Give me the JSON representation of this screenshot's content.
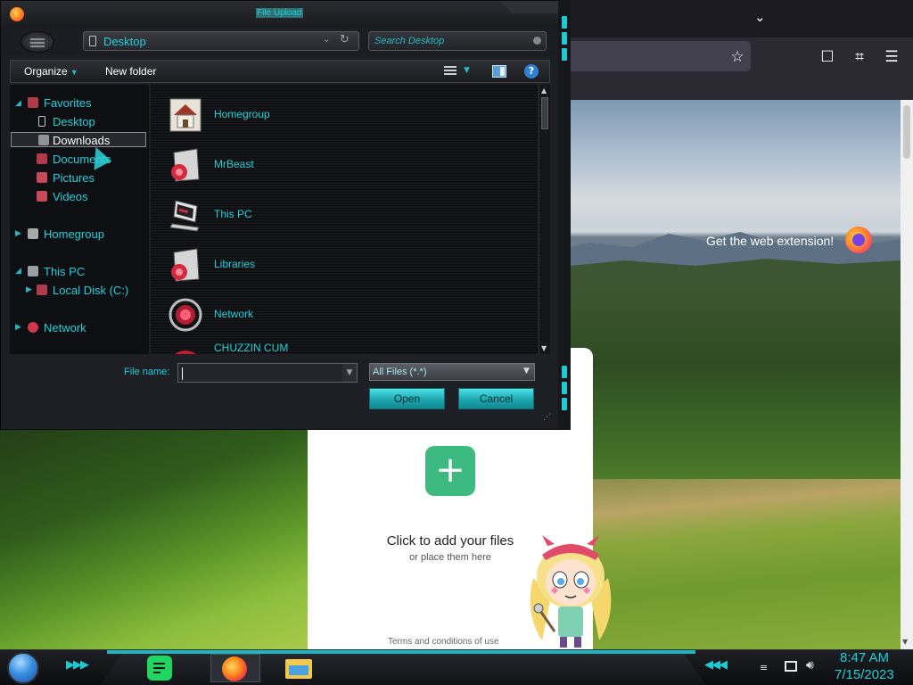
{
  "browser": {
    "banner_text": "Get the web extension!",
    "icons": [
      "chevron-down-icon",
      "bookmark-star-icon",
      "pocket-icon",
      "extensions-icon",
      "menu-icon"
    ]
  },
  "upload": {
    "title": "Click to add your files",
    "subtitle": "or place them here",
    "add_symbol": "+",
    "terms": "Terms and conditions of use"
  },
  "dialog": {
    "title": "File Upload",
    "address": "Desktop",
    "search_placeholder": "Search Desktop",
    "toolbar": {
      "organize_label": "Organize",
      "new_folder_label": "New folder",
      "help_label": "?"
    },
    "nav": {
      "favorites": "Favorites",
      "desktop": "Desktop",
      "downloads": "Downloads",
      "documents": "Documents",
      "pictures": "Pictures",
      "videos": "Videos",
      "homegroup": "Homegroup",
      "this_pc": "This PC",
      "local_disk": "Local Disk (C:)",
      "network": "Network",
      "selected": "Downloads"
    },
    "files": [
      {
        "name": "Homegroup",
        "icon": "homegroup-icon"
      },
      {
        "name": "MrBeast",
        "icon": "user-folder-icon"
      },
      {
        "name": "This PC",
        "icon": "computer-icon"
      },
      {
        "name": "Libraries",
        "icon": "libraries-icon"
      },
      {
        "name": "Network",
        "icon": "network-icon"
      },
      {
        "name": "CHUZZIN CUM",
        "icon": "folder-icon"
      }
    ],
    "file_name_label": "File name:",
    "file_name_value": "",
    "file_type": "All Files (*.*)",
    "open_label": "Open",
    "cancel_label": "Cancel"
  },
  "taskbar": {
    "time": "8:47 AM",
    "date": "7/15/2023",
    "apps": [
      "notes-icon",
      "firefox-icon",
      "file-explorer-icon"
    ]
  },
  "colors": {
    "accent_cyan": "#21d0d8",
    "add_button_green": "#3dba7f",
    "dialog_bg": "#1e1f24"
  }
}
